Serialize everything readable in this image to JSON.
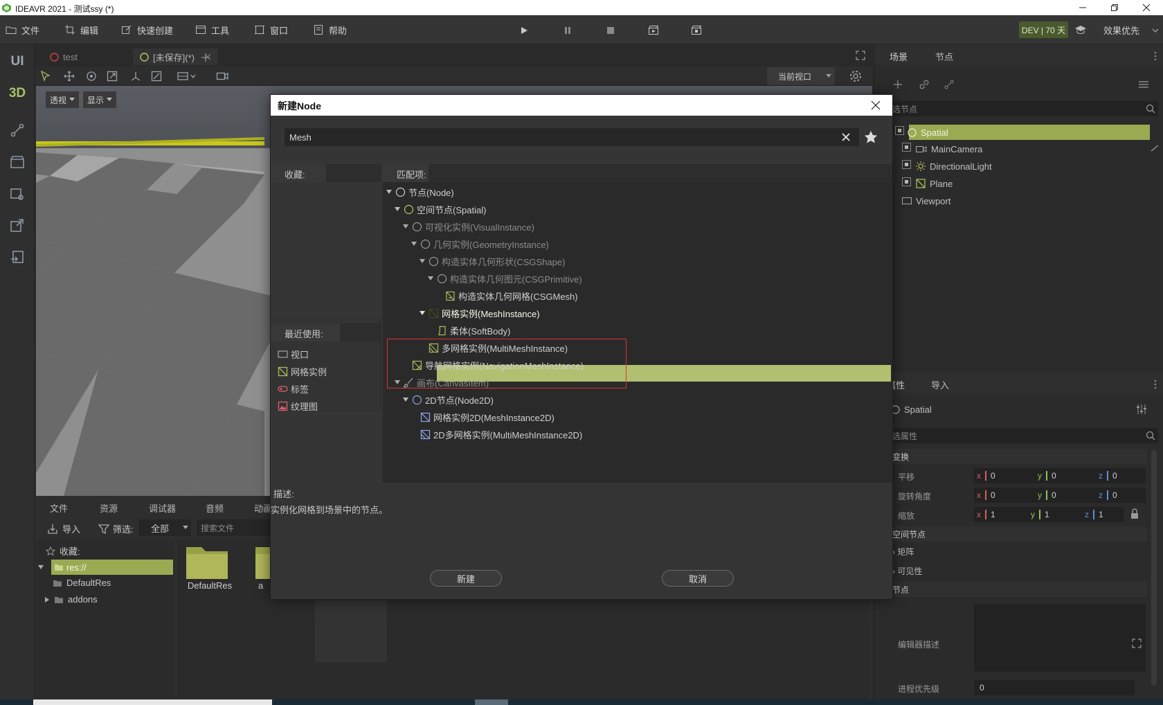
{
  "window": {
    "title": "IDEAVR 2021 - 测试ssy (*)"
  },
  "menu": {
    "items": [
      {
        "label": "文件",
        "icon": "folder-icon"
      },
      {
        "label": "编辑",
        "icon": "crop-icon"
      },
      {
        "label": "快速创建",
        "icon": "edit-icon"
      },
      {
        "label": "工具",
        "icon": "window-icon"
      },
      {
        "label": "窗口",
        "icon": "frame-icon"
      },
      {
        "label": "帮助",
        "icon": "book-icon"
      }
    ],
    "dev_badge": "DEV | 70 天",
    "quality": "效果优先"
  },
  "modebar": {
    "ui": "UI",
    "three_d": "3D"
  },
  "editor": {
    "tabs": [
      {
        "label": "test"
      },
      {
        "label": "[未保存](*)"
      }
    ],
    "view_mode": "透视",
    "display": "显示",
    "current_view": "当前视口"
  },
  "bottom": {
    "tabs": [
      "文件",
      "资源",
      "调试器",
      "音频",
      "动画"
    ],
    "import_label": "导入",
    "filter_label": "筛选:",
    "filter_value": "全部",
    "search_placeholder": "搜索文件",
    "favorites": "收藏:",
    "res_root": "res://",
    "tree": [
      "DefaultRes",
      "addons"
    ],
    "files": [
      "DefaultRes",
      "a"
    ]
  },
  "right": {
    "scene_tabs": [
      "场景",
      "节点"
    ],
    "filter_nodes": "选节点",
    "scene_tree": [
      {
        "label": "Spatial",
        "icon": "spatial-icon"
      },
      {
        "label": "MainCamera",
        "icon": "camera-icon"
      },
      {
        "label": "DirectionalLight",
        "icon": "light-icon"
      },
      {
        "label": "Plane",
        "icon": "mesh-icon"
      },
      {
        "label": "Viewport",
        "icon": "viewport-icon"
      }
    ],
    "inspector_tabs": [
      "属性",
      "导入"
    ],
    "inspector_object": "Spatial",
    "filter_props": "选属性",
    "transform": "变换",
    "translation": "平移",
    "rotation": "旋转角度",
    "scale": "缩放",
    "t_vals": [
      "0",
      "0",
      "0"
    ],
    "r_vals": [
      "0",
      "0",
      "0"
    ],
    "s_vals": [
      "1",
      "1",
      "1"
    ],
    "axes": [
      "x",
      "y",
      "z"
    ],
    "spatial_node": "空间节点",
    "matrix": "矩阵",
    "visibility": "可见性",
    "node": "节点",
    "editor_desc": "编辑器描述",
    "process_priority": "进程优先级",
    "priority_value": "0"
  },
  "dialog": {
    "title": "新建Node",
    "search_value": "Mesh",
    "favorites_label": "收藏:",
    "recent_label": "最近使用:",
    "recent": [
      {
        "label": "视口",
        "icon": "viewport-icon"
      },
      {
        "label": "网格实例",
        "icon": "mesh-icon"
      },
      {
        "label": "标签",
        "icon": "label-icon"
      },
      {
        "label": "纹理图",
        "icon": "texture-icon"
      }
    ],
    "matches_label": "匹配项:",
    "tree": [
      {
        "label": "节点(Node)"
      },
      {
        "label": "空间节点(Spatial)"
      },
      {
        "label": "可视化实例(VisualInstance)"
      },
      {
        "label": "几何实例(GeometryInstance)"
      },
      {
        "label": "构造实体几何形状(CSGShape)"
      },
      {
        "label": "构造实体几何图元(CSGPrimitive)"
      },
      {
        "label": "构造实体几何网格(CSGMesh)"
      },
      {
        "label": "网格实例(MeshInstance)"
      },
      {
        "label": "柔体(SoftBody)"
      },
      {
        "label": "多网格实例(MultiMeshInstance)"
      },
      {
        "label": "导航网格实例(NavigationMeshInstance)"
      },
      {
        "label": "画布(CanvasItem)"
      },
      {
        "label": "2D节点(Node2D)"
      },
      {
        "label": "网格实例2D(MeshInstance2D)"
      },
      {
        "label": "2D多网格实例(MultiMeshInstance2D)"
      }
    ],
    "description_label": "描述:",
    "description": "实例化网格到场景中的节点。",
    "create_button": "新建",
    "cancel_button": "取消"
  },
  "colors": {
    "selection": "#b0c070",
    "accent_yellow": "#d8d820",
    "red_box": "#e03030"
  }
}
